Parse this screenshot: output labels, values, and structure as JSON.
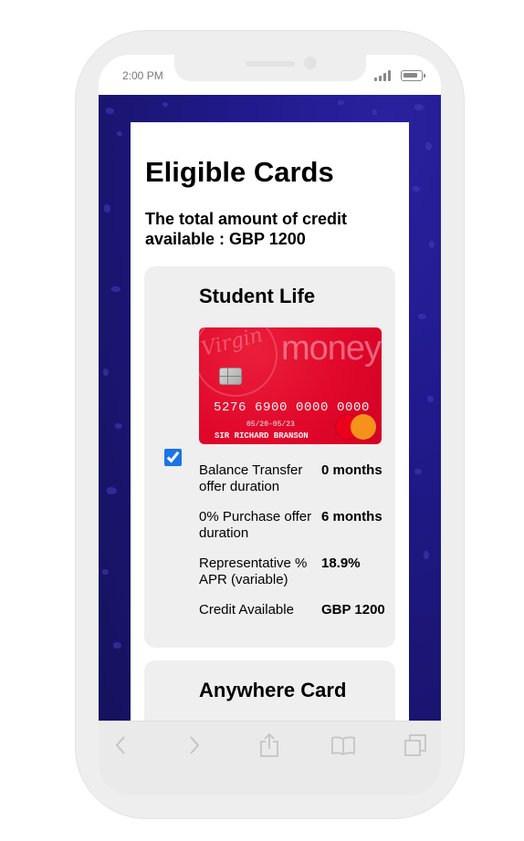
{
  "status_bar": {
    "time": "2:00 PM"
  },
  "page": {
    "title": "Eligible Cards",
    "credit_summary": "The total amount of credit available : GBP 1200"
  },
  "cards": [
    {
      "name": "Student Life",
      "selected": true,
      "card_image": {
        "brand_word": "money",
        "brand_script": "Virgin",
        "number": "5276 6900 0000 0000",
        "dates": "05/20-05/23",
        "holder": "SIR RICHARD BRANSON",
        "primary_color": "#e1082b"
      },
      "specs": [
        {
          "label": "Balance Transfer offer duration",
          "value": "0 months"
        },
        {
          "label": "0% Purchase offer duration",
          "value": "6 months"
        },
        {
          "label": "Representative % APR (variable)",
          "value": "18.9%"
        },
        {
          "label": "Credit Available",
          "value": "GBP 1200"
        }
      ]
    },
    {
      "name": "Anywhere Card"
    }
  ],
  "browser_toolbar": {
    "buttons": [
      "back-icon",
      "forward-icon",
      "share-icon",
      "bookmarks-icon",
      "tabs-icon"
    ]
  },
  "colors": {
    "background_accent": "#201a8d",
    "checkbox_accent": "#1a73e8"
  }
}
